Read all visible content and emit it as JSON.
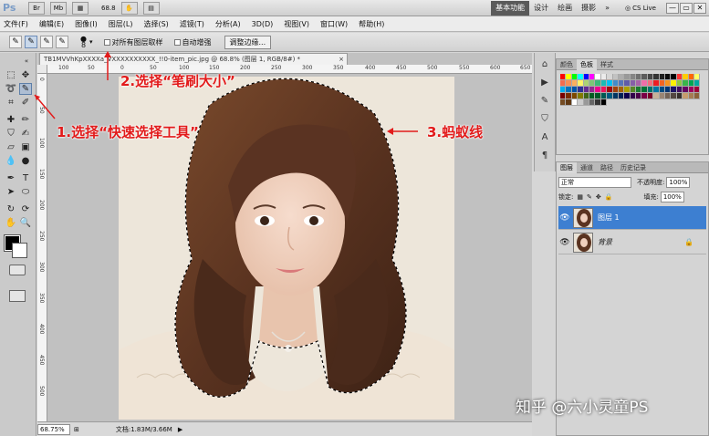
{
  "appbar": {
    "logo": "Ps",
    "buttons": [
      "Br",
      "Mb"
    ],
    "zoom": "68.8",
    "workspaces": [
      "基本功能",
      "设计",
      "绘画",
      "摄影"
    ],
    "active_workspace": "基本功能",
    "cs_live": "CS Live",
    "win_minimize": "—",
    "win_restore": "▭",
    "win_close": "✕"
  },
  "menu": [
    "文件(F)",
    "编辑(E)",
    "图像(I)",
    "图层(L)",
    "选择(S)",
    "滤镜(T)",
    "分析(A)",
    "3D(D)",
    "视图(V)",
    "窗口(W)",
    "帮助(H)"
  ],
  "options": {
    "brush_size": "8",
    "sample_all_layers": "对所有图层取样",
    "auto_enhance": "自动增强",
    "refine_edge": "调整边缘..."
  },
  "document": {
    "tab_title": "TB1MVVhKpXXXXa_VXXXXXXXXXX_!!0-item_pic.jpg @ 68.8% (图层 1, RGB/8#) *",
    "tab_close": "×",
    "ruler_top": [
      "100",
      "50",
      "0",
      "50",
      "100",
      "150",
      "200",
      "250",
      "300",
      "350",
      "400",
      "450",
      "500",
      "550",
      "600",
      "650"
    ],
    "ruler_left": [
      "0",
      "50",
      "100",
      "150",
      "200",
      "250",
      "300",
      "350",
      "400",
      "450",
      "500"
    ]
  },
  "status": {
    "zoom": "68.75%",
    "doc_info": "文档:1.83M/3.66M"
  },
  "swatches": {
    "tabs": [
      "颜色",
      "色板",
      "样式"
    ],
    "active_tab": "色板",
    "colors": [
      "#ff0000",
      "#ffff00",
      "#00ff00",
      "#00ffff",
      "#0000ff",
      "#ff00ff",
      "#ffffff",
      "#ebebeb",
      "#d6d6d6",
      "#c2c2c2",
      "#adadad",
      "#999999",
      "#858585",
      "#707070",
      "#5c5c5c",
      "#474747",
      "#333333",
      "#1f1f1f",
      "#0a0a0a",
      "#000000",
      "#ff3333",
      "#ffcc00",
      "#ff6600",
      "#ffff66",
      "#f26c4f",
      "#f68e55",
      "#fbaf5d",
      "#fff467",
      "#acd373",
      "#7cc576",
      "#3bb878",
      "#1abbb4",
      "#00bff3",
      "#438cca",
      "#5574b9",
      "#605ca8",
      "#855fa8",
      "#a763a8",
      "#f06ea9",
      "#f26d7d",
      "#ed1c24",
      "#f26522",
      "#f7941d",
      "#fff200",
      "#8dc73f",
      "#39b54a",
      "#00a651",
      "#00a99d",
      "#00aeef",
      "#0072bc",
      "#0054a6",
      "#2e3192",
      "#662d91",
      "#92278f",
      "#ec008c",
      "#ed145b",
      "#9e0b0f",
      "#a0410d",
      "#a36209",
      "#aba000",
      "#598527",
      "#197b30",
      "#007236",
      "#00746b",
      "#0076a3",
      "#004b80",
      "#003471",
      "#1b1464",
      "#440e62",
      "#630460",
      "#9e005d",
      "#9e0039",
      "#790000",
      "#7b2e00",
      "#7d4900",
      "#827b00",
      "#406618",
      "#005e20",
      "#005826",
      "#005952",
      "#005b7f",
      "#003663",
      "#002157",
      "#0d004c",
      "#32004b",
      "#4b0049",
      "#7b0046",
      "#7a0026",
      "#c7b299",
      "#998675",
      "#736357",
      "#534741",
      "#37302d",
      "#c69c6d",
      "#a67c52",
      "#8c6239",
      "#754c24",
      "#603913",
      "#ffffff",
      "#cccccc",
      "#999999",
      "#666666",
      "#333333",
      "#000000"
    ]
  },
  "layers": {
    "tabs": [
      "图层",
      "通道",
      "路径",
      "历史记录"
    ],
    "active_tab": "图层",
    "blend_mode": "正常",
    "opacity_label": "不透明度:",
    "opacity": "100%",
    "lock_label": "锁定:",
    "fill_label": "填充:",
    "fill": "100%",
    "items": [
      {
        "name": "图层 1",
        "selected": true,
        "locked": false
      },
      {
        "name": "背景",
        "selected": false,
        "locked": true
      }
    ]
  },
  "annotations": {
    "step1": "1.选择“快速选择工具”",
    "step2": "2.选择“笔刷大小”",
    "step3": "3.蚂蚁线"
  },
  "watermark": "知乎 @六小灵童PS",
  "colors": {
    "annotation": "#e21b1b",
    "selected_layer": "#3d7fd1",
    "workspace_active": "#5a5a5a"
  }
}
